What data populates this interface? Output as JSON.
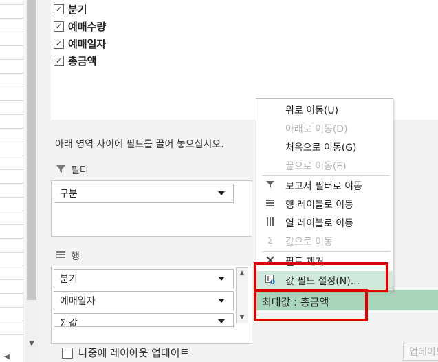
{
  "field_list": {
    "items": [
      {
        "label": "분기",
        "checked": true
      },
      {
        "label": "예매수량",
        "checked": true
      },
      {
        "label": "예매일자",
        "checked": true
      },
      {
        "label": "총금액",
        "checked": true
      }
    ]
  },
  "hint_text": "아래 영역 사이에 필드를 끌어 놓으십시오.",
  "areas": {
    "filter": {
      "title": "필터",
      "items": [
        "구분"
      ]
    },
    "rows": {
      "title": "행",
      "items": [
        "분기",
        "예매일자",
        "Σ 값"
      ]
    },
    "values": {
      "items": [
        "최대값 : 총금액"
      ]
    }
  },
  "context_menu": {
    "items": [
      {
        "label": "위로 이동(U)",
        "enabled": true,
        "icon": ""
      },
      {
        "label": "아래로 이동(D)",
        "enabled": false,
        "icon": ""
      },
      {
        "label": "처음으로 이동(G)",
        "enabled": true,
        "icon": ""
      },
      {
        "label": "끝으로 이동(E)",
        "enabled": false,
        "icon": ""
      },
      {
        "label": "보고서 필터로 이동",
        "enabled": true,
        "icon": "filter-icon"
      },
      {
        "label": "행 레이블로 이동",
        "enabled": true,
        "icon": "rows-icon"
      },
      {
        "label": "열 레이블로 이동",
        "enabled": true,
        "icon": "columns-icon"
      },
      {
        "label": "값으로 이동",
        "enabled": false,
        "icon": "sigma-icon"
      },
      {
        "label": "필드 제거",
        "enabled": true,
        "icon": "remove-icon"
      },
      {
        "label": "값 필드 설정(N)...",
        "enabled": true,
        "icon": "field-settings-icon",
        "highlighted": true
      }
    ]
  },
  "footer": {
    "defer_label": "나중에 레이아웃 업데이트",
    "update_label": "업데이트"
  },
  "colors": {
    "highlight_green": "#cfe9dc",
    "values_green": "#a9d5bd",
    "annotation_red": "#e00000"
  }
}
